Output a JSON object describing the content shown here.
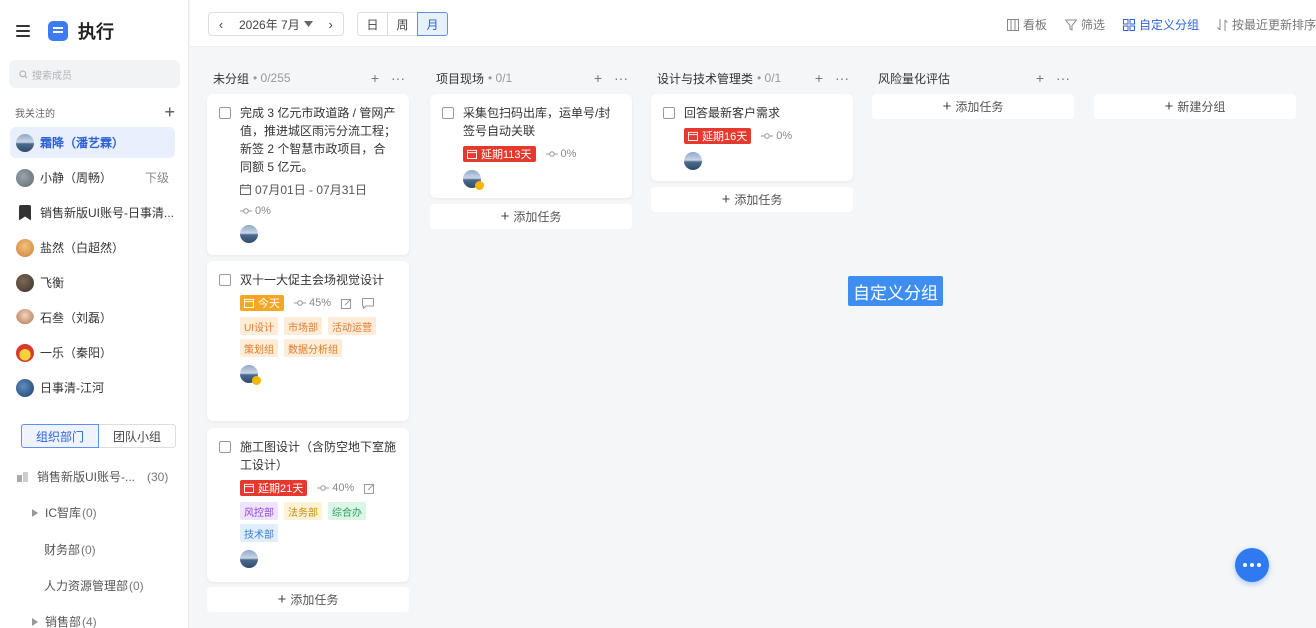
{
  "app": {
    "title": "执行"
  },
  "sidebar": {
    "search_placeholder": "搜索成员",
    "following_label": "我关注的",
    "members": [
      {
        "name": "霜降（潘艺霖）",
        "extra": ""
      },
      {
        "name": "小静（周畅）",
        "extra": "下级"
      },
      {
        "name": "销售新版UI账号-日事清...",
        "extra": ""
      },
      {
        "name": "盐然（白超然）",
        "extra": ""
      },
      {
        "name": "飞衡",
        "extra": ""
      },
      {
        "name": "石叁（刘磊）",
        "extra": ""
      },
      {
        "name": "一乐（秦阳）",
        "extra": ""
      },
      {
        "name": "日事清-江河",
        "extra": ""
      }
    ],
    "tabs": [
      "组织部门",
      "团队小组"
    ],
    "org": [
      {
        "name": "销售新版UI账号-...",
        "count": "(30)"
      },
      {
        "name": "IC智库",
        "count": "(0)"
      },
      {
        "name": "财务部",
        "count": "(0)"
      },
      {
        "name": "人力资源管理部",
        "count": "(0)"
      },
      {
        "name": "销售部",
        "count": "(4)"
      }
    ]
  },
  "toolbar": {
    "month": "2026年 7月",
    "views": [
      "日",
      "周",
      "月"
    ],
    "tools": [
      "看板",
      "筛选",
      "自定义分组",
      "按最近更新排序"
    ]
  },
  "columns": [
    {
      "title": "未分组",
      "sub": "• 0/255"
    },
    {
      "title": "项目现场",
      "sub": "• 0/1"
    },
    {
      "title": "设计与技术管理类",
      "sub": "• 0/1"
    },
    {
      "title": "风险量化评估",
      "sub": ""
    }
  ],
  "cards": {
    "c1": {
      "title": "完成 3 亿元市政道路 / 管网产值，推进城区雨污分流工程；新签 2 个智慧市政项目，合同额 5 亿元。",
      "date": "07月01日 - 07月31日",
      "progress": "0%"
    },
    "c2": {
      "title": "双十一大促主会场视觉设计",
      "badge": "今天",
      "progress": "45%",
      "tags": [
        "UI设计",
        "市场部",
        "活动运营",
        "策划组",
        "数据分析组"
      ]
    },
    "c3": {
      "title": "施工图设计（含防空地下室施工设计）",
      "badge": "延期21天",
      "progress": "40%",
      "tags": [
        "风控部",
        "法务部",
        "综合办",
        "技术部"
      ]
    },
    "c4": {
      "title": "采集包扫码出库，运单号/封签号自动关联",
      "badge": "延期113天",
      "progress": "0%"
    },
    "c5": {
      "title": "回答最新客户需求",
      "badge": "延期16天",
      "progress": "0%"
    }
  },
  "labels": {
    "add_task": "添加任务",
    "new_group": "新建分组",
    "overlay": "自定义分组"
  }
}
